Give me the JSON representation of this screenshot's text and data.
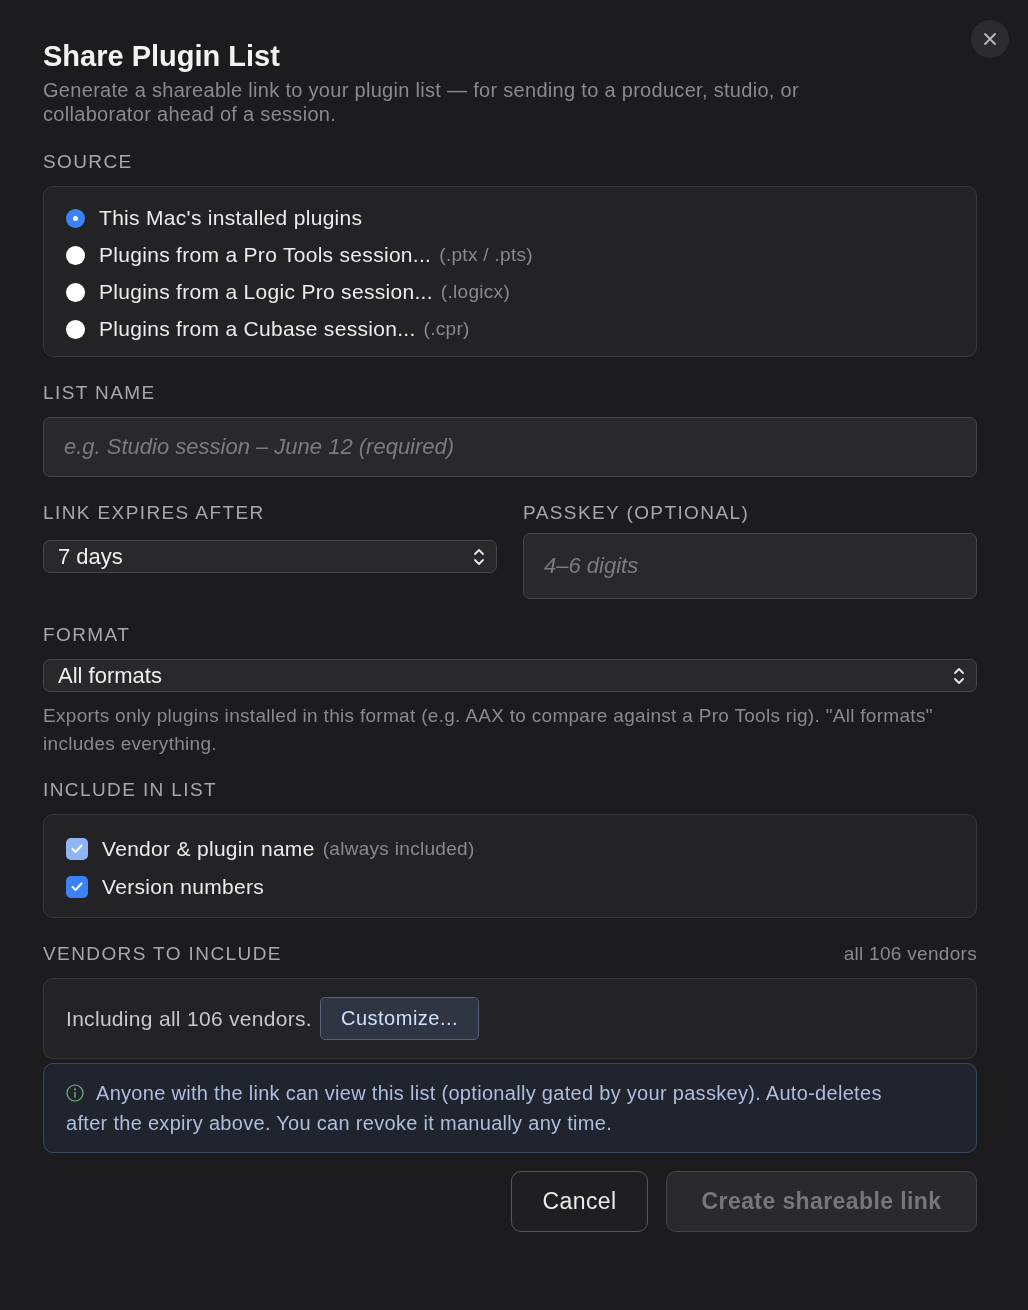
{
  "dialog": {
    "title": "Share Plugin List",
    "subtitle": "Generate a shareable link to your plugin list — for sending to a producer, studio, or collaborator ahead of a session."
  },
  "source": {
    "label": "SOURCE",
    "options": [
      {
        "label": "This Mac's installed plugins",
        "selected": true
      },
      {
        "label": "Plugins from a Pro Tools session...",
        "hint": "(.ptx / .pts)",
        "selected": false
      },
      {
        "label": "Plugins from a Logic Pro session...",
        "hint": "(.logicx)",
        "selected": false
      },
      {
        "label": "Plugins from a Cubase session...",
        "hint": "(.cpr)",
        "selected": false
      }
    ]
  },
  "list_name": {
    "label": "LIST NAME",
    "placeholder": "e.g. Studio session – June 12 (required)"
  },
  "link_expires": {
    "label": "LINK EXPIRES AFTER",
    "value": "7 days"
  },
  "passkey": {
    "label": "PASSKEY (OPTIONAL)",
    "placeholder": "4–6 digits"
  },
  "format": {
    "label": "FORMAT",
    "value": "All formats",
    "help": "Exports only plugins installed in this format (e.g. AAX to compare against a Pro Tools rig). \"All formats\" includes everything."
  },
  "include": {
    "label": "INCLUDE IN LIST",
    "items": [
      {
        "label": "Vendor & plugin name",
        "hint": "(always included)",
        "checked": true,
        "disabled": true
      },
      {
        "label": "Version numbers",
        "checked": true,
        "disabled": false
      }
    ]
  },
  "vendors": {
    "label": "VENDORS TO INCLUDE",
    "count": "all 106 vendors",
    "summary": "Including all 106 vendors.",
    "button": "Customize..."
  },
  "notice": {
    "text": "Anyone with the link can view this list (optionally gated by your passkey). Auto-deletes after the expiry above. You can revoke it manually any time."
  },
  "buttons": [
    {
      "label": "Cancel",
      "kind": "secondary"
    },
    {
      "label": "Create shareable link",
      "kind": "primary",
      "disabled": true
    }
  ]
}
